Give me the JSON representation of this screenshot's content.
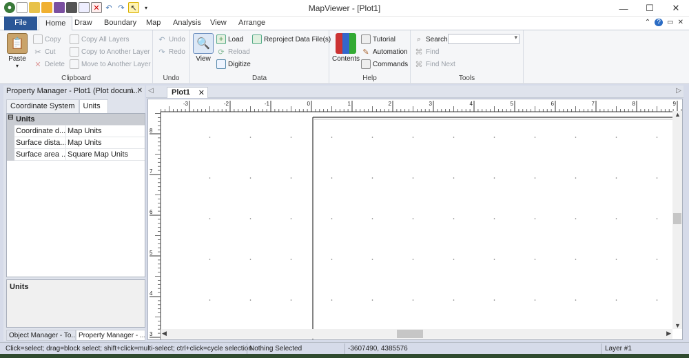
{
  "window": {
    "title": "MapViewer - [Plot1]",
    "controls": [
      "—",
      "☐",
      "✕"
    ]
  },
  "qat_icons": [
    "app-icon",
    "new-icon",
    "open-icon",
    "folder-icon",
    "save-icon",
    "print-icon",
    "preview-icon",
    "close-doc-icon",
    "undo-icon",
    "redo-icon",
    "select-icon"
  ],
  "tabs": [
    {
      "label": "File"
    },
    {
      "label": "Home"
    },
    {
      "label": "Draw"
    },
    {
      "label": "Boundary"
    },
    {
      "label": "Map"
    },
    {
      "label": "Analysis"
    },
    {
      "label": "View"
    },
    {
      "label": "Arrange"
    }
  ],
  "ribbon": {
    "clipboard": {
      "label": "Clipboard",
      "paste": "Paste",
      "copy": "Copy",
      "cut": "Cut",
      "delete": "Delete",
      "copy_all": "Copy All Layers",
      "copy_to": "Copy to Another Layer",
      "move_to": "Move to Another Layer"
    },
    "undo": {
      "label": "Undo",
      "undo": "Undo",
      "redo": "Redo"
    },
    "data": {
      "label": "Data",
      "view": "View",
      "load": "Load",
      "reload": "Reload",
      "digitize": "Digitize",
      "reproject": "Reproject Data File(s)"
    },
    "help": {
      "label": "Help",
      "contents": "Contents",
      "tutorial": "Tutorial",
      "automation": "Automation",
      "commands": "Commands"
    },
    "tools": {
      "label": "Tools",
      "search": "Search:",
      "search_value": "",
      "find": "Find",
      "find_next": "Find Next"
    }
  },
  "property_manager": {
    "title": "Property Manager - Plot1 (Plot docum...",
    "pins": "⊥ ✕",
    "tabs": [
      "Coordinate System",
      "Units"
    ],
    "category": "Units",
    "rows": [
      {
        "key": "Coordinate d...",
        "value": "Map Units"
      },
      {
        "key": "Surface dista...",
        "value": "Map Units"
      },
      {
        "key": "Surface area ...",
        "value": "Square Map Units"
      }
    ],
    "help_title": "Units",
    "bottom_tabs": [
      "Object Manager - To...",
      "Property Manager - ..."
    ]
  },
  "document": {
    "tab": "Plot1",
    "close": "✕",
    "ruler_top_labels": [
      "-3",
      "-2",
      "-1",
      "0",
      "1",
      "2",
      "3",
      "4",
      "5",
      "6",
      "7",
      "8",
      "9"
    ],
    "ruler_left_labels": [
      "8",
      "7",
      "6",
      "5",
      "4",
      "3"
    ]
  },
  "status": {
    "hint": "Click=select; drag=block select; shift+click=multi-select; ctrl+click=cycle selection",
    "selection": "Nothing Selected",
    "coords": "-3607490, 4385576",
    "layer": "Layer #1"
  }
}
